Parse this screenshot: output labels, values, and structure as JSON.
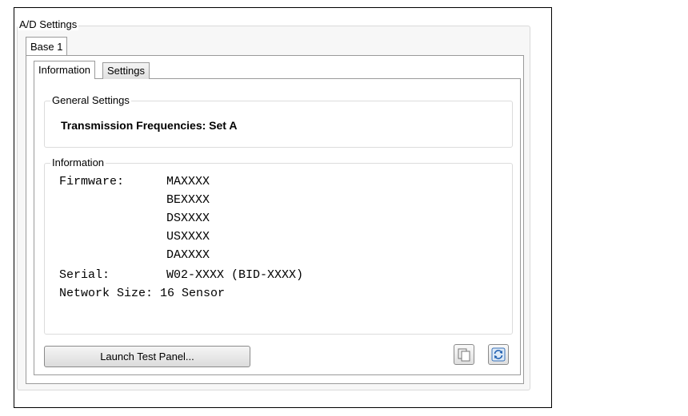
{
  "ad_settings": {
    "group_label": "A/D Settings",
    "base_tab_label": "Base 1",
    "tabs": [
      {
        "label": "Information",
        "active": true
      },
      {
        "label": "Settings",
        "active": false
      }
    ],
    "general_settings": {
      "label": "General Settings",
      "transmission": "Transmission Frequencies: Set A"
    },
    "information": {
      "label": "Information",
      "firmware_key": "Firmware:",
      "firmware_values": [
        "MAXXXX",
        "BEXXXX",
        "DSXXXX",
        "USXXXX",
        "DAXXXX"
      ],
      "serial_key": "Serial:",
      "serial_value": "W02-XXXX (BID-XXXX)",
      "network_text": "Network Size: 16 Sensor"
    },
    "launch_button": "Launch Test Panel...",
    "icons": [
      "copy-icon",
      "refresh-icon"
    ]
  }
}
